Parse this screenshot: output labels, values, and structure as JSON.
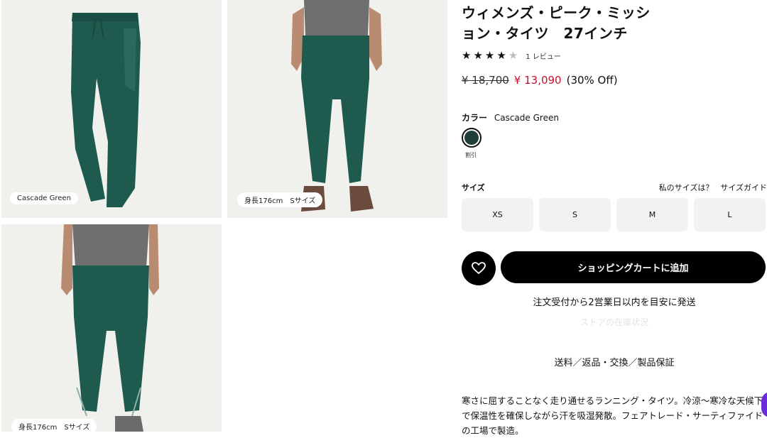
{
  "gallery": {
    "captions": [
      "Cascade Green",
      "身長176cm　Sサイズ",
      "身長176cm　Sサイズ"
    ]
  },
  "product": {
    "title": "ウィメンズ・ピーク・ミッション・タイツ　27インチ",
    "rating_value": 4,
    "rating_max": 5,
    "review_count": "1 レビュー",
    "price_original": "¥ 18,700",
    "price_sale": "¥ 13,090",
    "price_discount": "(30% Off)",
    "color_label": "カラー",
    "color_name": "Cascade Green",
    "swatch_color": "#1f3f3a",
    "swatch_tag": "割引",
    "size_label": "サイズ",
    "my_size": "私のサイズは？",
    "size_guide": "サイズガイド",
    "sizes": [
      "XS",
      "S",
      "M",
      "L"
    ],
    "add_to_cart": "ショッピングカートに追加",
    "ship_note": "注文受付から2営業日以内を目安に発送",
    "store_stock": "ストアの在庫状況",
    "policy": "送料／返品・交換／製品保証",
    "description": "寒さに屈することなく走り通せるランニング・タイツ。冷涼〜寒冷な天候下で保温性を確保しながら汗を吸湿発散。フェアトレード・サーティファイドの工場で製造。"
  },
  "colors": {
    "legging": "#1f5a4e",
    "sale": "#c8102e",
    "accent": "#6a2bd9"
  }
}
